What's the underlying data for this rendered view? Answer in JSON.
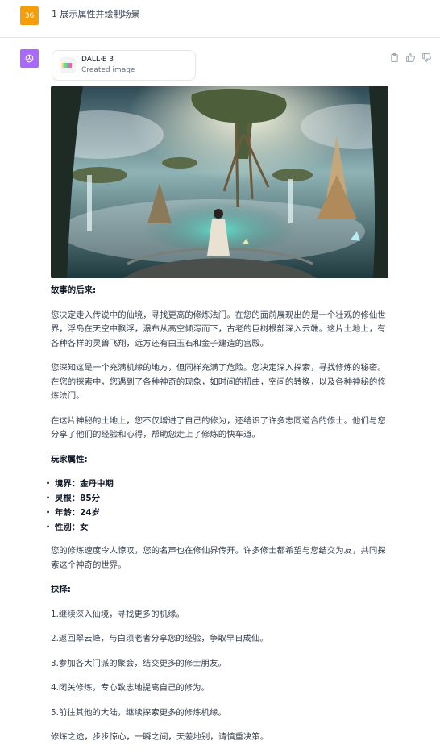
{
  "user": {
    "avatar_text": "36",
    "message": "1 展示属性并绘制场景"
  },
  "assistant": {
    "avatar_icon": "openai-logo-icon",
    "actions": [
      "clipboard-icon",
      "thumbs-up-icon",
      "thumbs-down-icon"
    ],
    "tool": {
      "name": "DALL·E 3",
      "subtitle": "Created image"
    },
    "image_icon": "generated-fantasy-image",
    "story_heading": "故事的后来:",
    "paragraphs": [
      "您决定走入传说中的仙境，寻找更高的修炼法门。在您的面前展现出的是一个壮观的修仙世界，浮岛在天空中飘浮，瀑布从高空倾泻而下，古老的巨树根部深入云端。这片土地上，有各种各样的灵兽飞翔，远方还有由玉石和金子建造的宫殿。",
      "您深知这是一个充满机缘的地方，但同样充满了危险。您决定深入探索，寻找修炼的秘密。在您的探索中，您遇到了各种神奇的现象，如时间的扭曲，空间的转换，以及各种神秘的修炼法门。",
      "在这片神秘的土地上，您不仅增进了自己的修为，还结识了许多志同道合的修士。他们与您分享了他们的经验和心得，帮助您走上了修炼的快车道。"
    ],
    "attributes_heading": "玩家属性:",
    "attributes": [
      "境界：金丹中期",
      "灵根：85分",
      "年龄：24岁",
      "性别：女"
    ],
    "summary": "您的修炼速度令人惊叹，您的名声也在修仙界传开。许多修士都希望与您结交为友，共同探索这个神奇的世界。",
    "choices_heading": "抉择:",
    "choices": [
      "1.继续深入仙境，寻找更多的机缘。",
      "2.返回翠云峰，与白须老者分享您的经验，争取早日成仙。",
      "3.参加各大门派的聚会，结交更多的修士朋友。",
      "4.闭关修炼，专心致志地提高自己的修为。",
      "5.前往其他的大陆，继续探索更多的修炼机缘。"
    ],
    "closing": "修炼之途，步步惊心，一瞬之间，天差地别，请慎重决策。"
  }
}
